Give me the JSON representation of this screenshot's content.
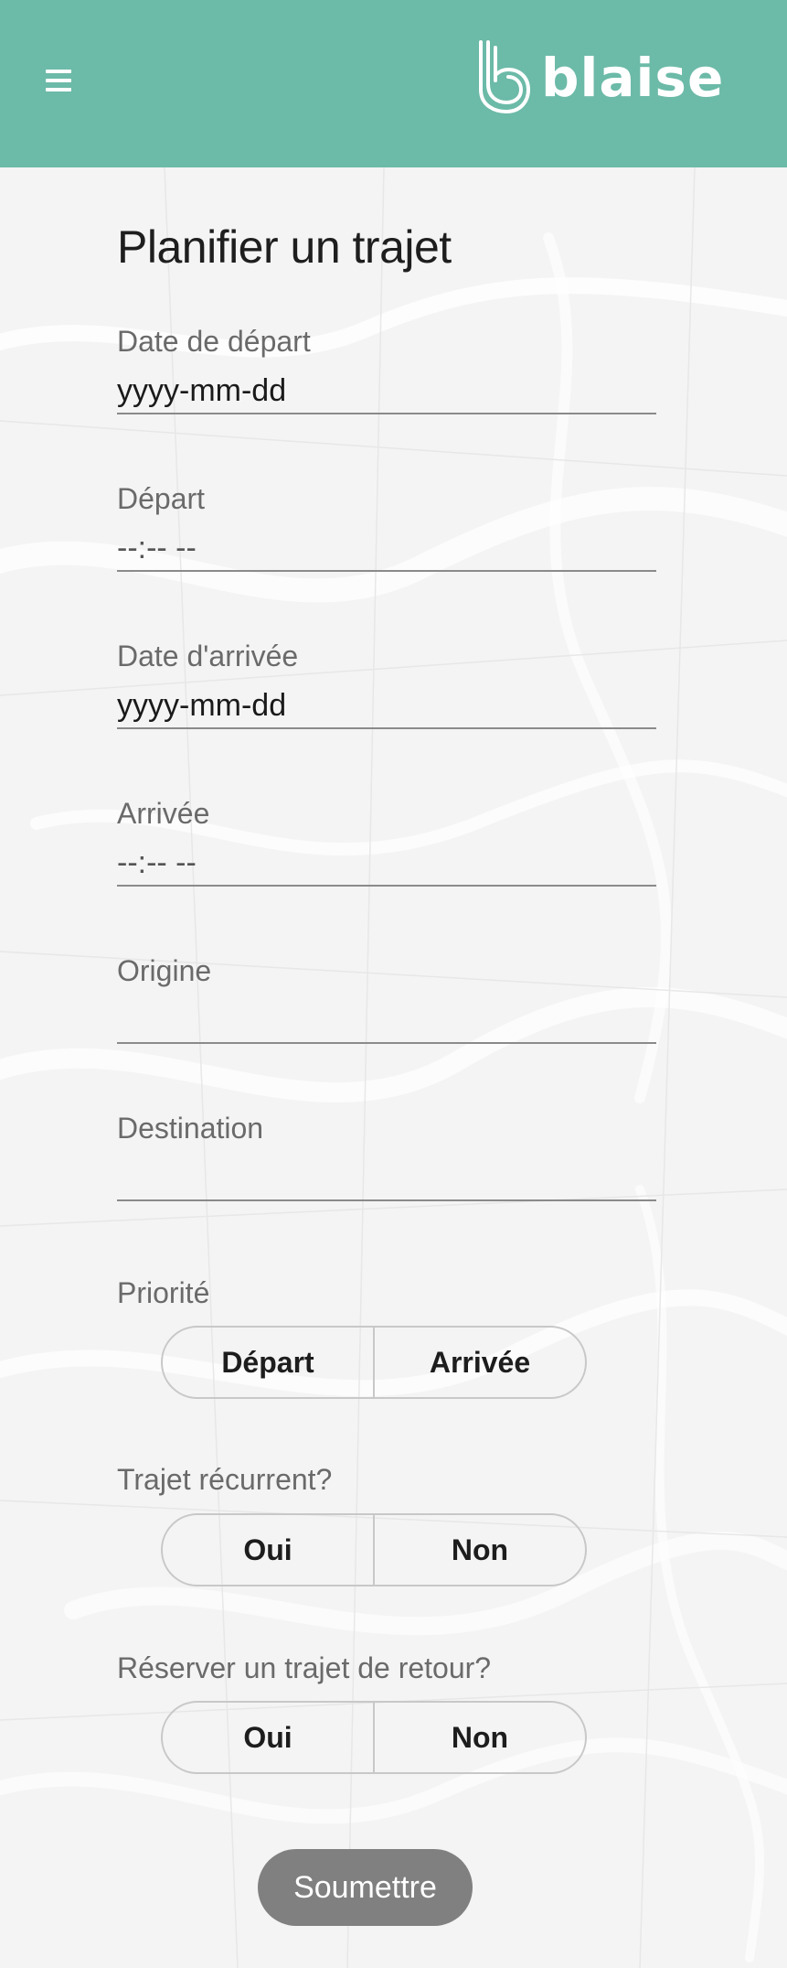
{
  "header": {
    "brand": "blaise",
    "menu_icon": "hamburger-menu-icon",
    "logo_icon": "blaise-logo-mark"
  },
  "colors": {
    "header_bg": "#6cbaa8",
    "page_bg": "#f5f5f5",
    "submit_bg": "#808080",
    "underline": "#8a8a8a"
  },
  "form": {
    "title": "Planifier un trajet",
    "fields": [
      {
        "label": "Date de départ",
        "placeholder": "yyyy-mm-dd",
        "value": ""
      },
      {
        "label": "Départ",
        "placeholder": "--:-- --",
        "value": ""
      },
      {
        "label": "Date d'arrivée",
        "placeholder": "yyyy-mm-dd",
        "value": ""
      },
      {
        "label": "Arrivée",
        "placeholder": "--:-- --",
        "value": ""
      },
      {
        "label": "Origine",
        "placeholder": "",
        "value": ""
      },
      {
        "label": "Destination",
        "placeholder": "",
        "value": ""
      }
    ],
    "priority": {
      "label": "Priorité",
      "options": [
        "Départ",
        "Arrivée"
      ]
    },
    "recurring": {
      "label": "Trajet récurrent?",
      "options": [
        "Oui",
        "Non"
      ]
    },
    "return_trip": {
      "label": "Réserver un trajet de retour?",
      "options": [
        "Oui",
        "Non"
      ]
    },
    "submit_label": "Soumettre"
  }
}
